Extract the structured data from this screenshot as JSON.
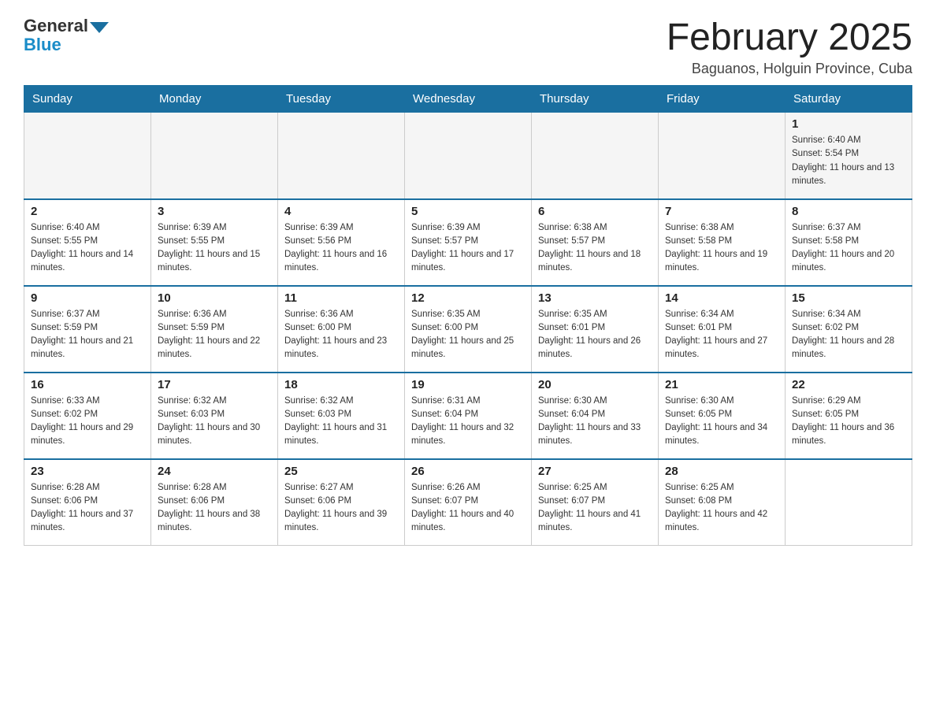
{
  "header": {
    "logo_general": "General",
    "logo_blue": "Blue",
    "month_title": "February 2025",
    "location": "Baguanos, Holguin Province, Cuba"
  },
  "days_of_week": [
    "Sunday",
    "Monday",
    "Tuesday",
    "Wednesday",
    "Thursday",
    "Friday",
    "Saturday"
  ],
  "weeks": [
    {
      "days": [
        {
          "number": "",
          "sunrise": "",
          "sunset": "",
          "daylight": ""
        },
        {
          "number": "",
          "sunrise": "",
          "sunset": "",
          "daylight": ""
        },
        {
          "number": "",
          "sunrise": "",
          "sunset": "",
          "daylight": ""
        },
        {
          "number": "",
          "sunrise": "",
          "sunset": "",
          "daylight": ""
        },
        {
          "number": "",
          "sunrise": "",
          "sunset": "",
          "daylight": ""
        },
        {
          "number": "",
          "sunrise": "",
          "sunset": "",
          "daylight": ""
        },
        {
          "number": "1",
          "sunrise": "Sunrise: 6:40 AM",
          "sunset": "Sunset: 5:54 PM",
          "daylight": "Daylight: 11 hours and 13 minutes."
        }
      ]
    },
    {
      "days": [
        {
          "number": "2",
          "sunrise": "Sunrise: 6:40 AM",
          "sunset": "Sunset: 5:55 PM",
          "daylight": "Daylight: 11 hours and 14 minutes."
        },
        {
          "number": "3",
          "sunrise": "Sunrise: 6:39 AM",
          "sunset": "Sunset: 5:55 PM",
          "daylight": "Daylight: 11 hours and 15 minutes."
        },
        {
          "number": "4",
          "sunrise": "Sunrise: 6:39 AM",
          "sunset": "Sunset: 5:56 PM",
          "daylight": "Daylight: 11 hours and 16 minutes."
        },
        {
          "number": "5",
          "sunrise": "Sunrise: 6:39 AM",
          "sunset": "Sunset: 5:57 PM",
          "daylight": "Daylight: 11 hours and 17 minutes."
        },
        {
          "number": "6",
          "sunrise": "Sunrise: 6:38 AM",
          "sunset": "Sunset: 5:57 PM",
          "daylight": "Daylight: 11 hours and 18 minutes."
        },
        {
          "number": "7",
          "sunrise": "Sunrise: 6:38 AM",
          "sunset": "Sunset: 5:58 PM",
          "daylight": "Daylight: 11 hours and 19 minutes."
        },
        {
          "number": "8",
          "sunrise": "Sunrise: 6:37 AM",
          "sunset": "Sunset: 5:58 PM",
          "daylight": "Daylight: 11 hours and 20 minutes."
        }
      ]
    },
    {
      "days": [
        {
          "number": "9",
          "sunrise": "Sunrise: 6:37 AM",
          "sunset": "Sunset: 5:59 PM",
          "daylight": "Daylight: 11 hours and 21 minutes."
        },
        {
          "number": "10",
          "sunrise": "Sunrise: 6:36 AM",
          "sunset": "Sunset: 5:59 PM",
          "daylight": "Daylight: 11 hours and 22 minutes."
        },
        {
          "number": "11",
          "sunrise": "Sunrise: 6:36 AM",
          "sunset": "Sunset: 6:00 PM",
          "daylight": "Daylight: 11 hours and 23 minutes."
        },
        {
          "number": "12",
          "sunrise": "Sunrise: 6:35 AM",
          "sunset": "Sunset: 6:00 PM",
          "daylight": "Daylight: 11 hours and 25 minutes."
        },
        {
          "number": "13",
          "sunrise": "Sunrise: 6:35 AM",
          "sunset": "Sunset: 6:01 PM",
          "daylight": "Daylight: 11 hours and 26 minutes."
        },
        {
          "number": "14",
          "sunrise": "Sunrise: 6:34 AM",
          "sunset": "Sunset: 6:01 PM",
          "daylight": "Daylight: 11 hours and 27 minutes."
        },
        {
          "number": "15",
          "sunrise": "Sunrise: 6:34 AM",
          "sunset": "Sunset: 6:02 PM",
          "daylight": "Daylight: 11 hours and 28 minutes."
        }
      ]
    },
    {
      "days": [
        {
          "number": "16",
          "sunrise": "Sunrise: 6:33 AM",
          "sunset": "Sunset: 6:02 PM",
          "daylight": "Daylight: 11 hours and 29 minutes."
        },
        {
          "number": "17",
          "sunrise": "Sunrise: 6:32 AM",
          "sunset": "Sunset: 6:03 PM",
          "daylight": "Daylight: 11 hours and 30 minutes."
        },
        {
          "number": "18",
          "sunrise": "Sunrise: 6:32 AM",
          "sunset": "Sunset: 6:03 PM",
          "daylight": "Daylight: 11 hours and 31 minutes."
        },
        {
          "number": "19",
          "sunrise": "Sunrise: 6:31 AM",
          "sunset": "Sunset: 6:04 PM",
          "daylight": "Daylight: 11 hours and 32 minutes."
        },
        {
          "number": "20",
          "sunrise": "Sunrise: 6:30 AM",
          "sunset": "Sunset: 6:04 PM",
          "daylight": "Daylight: 11 hours and 33 minutes."
        },
        {
          "number": "21",
          "sunrise": "Sunrise: 6:30 AM",
          "sunset": "Sunset: 6:05 PM",
          "daylight": "Daylight: 11 hours and 34 minutes."
        },
        {
          "number": "22",
          "sunrise": "Sunrise: 6:29 AM",
          "sunset": "Sunset: 6:05 PM",
          "daylight": "Daylight: 11 hours and 36 minutes."
        }
      ]
    },
    {
      "days": [
        {
          "number": "23",
          "sunrise": "Sunrise: 6:28 AM",
          "sunset": "Sunset: 6:06 PM",
          "daylight": "Daylight: 11 hours and 37 minutes."
        },
        {
          "number": "24",
          "sunrise": "Sunrise: 6:28 AM",
          "sunset": "Sunset: 6:06 PM",
          "daylight": "Daylight: 11 hours and 38 minutes."
        },
        {
          "number": "25",
          "sunrise": "Sunrise: 6:27 AM",
          "sunset": "Sunset: 6:06 PM",
          "daylight": "Daylight: 11 hours and 39 minutes."
        },
        {
          "number": "26",
          "sunrise": "Sunrise: 6:26 AM",
          "sunset": "Sunset: 6:07 PM",
          "daylight": "Daylight: 11 hours and 40 minutes."
        },
        {
          "number": "27",
          "sunrise": "Sunrise: 6:25 AM",
          "sunset": "Sunset: 6:07 PM",
          "daylight": "Daylight: 11 hours and 41 minutes."
        },
        {
          "number": "28",
          "sunrise": "Sunrise: 6:25 AM",
          "sunset": "Sunset: 6:08 PM",
          "daylight": "Daylight: 11 hours and 42 minutes."
        },
        {
          "number": "",
          "sunrise": "",
          "sunset": "",
          "daylight": ""
        }
      ]
    }
  ]
}
